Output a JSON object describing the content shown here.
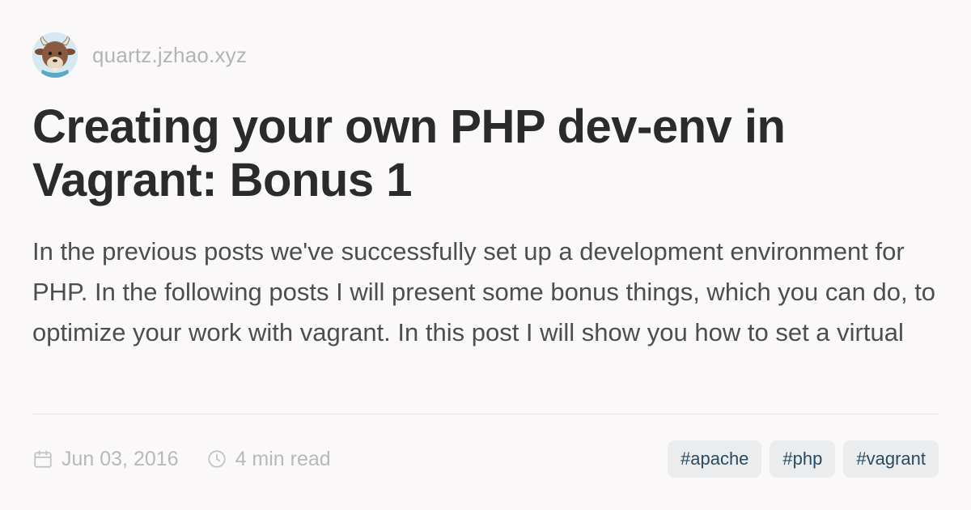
{
  "header": {
    "site_name": "quartz.jzhao.xyz",
    "avatar_icon": "goat-avatar-icon"
  },
  "article": {
    "title": "Creating your own PHP dev-env in Vagrant: Bonus 1",
    "description": "In the previous posts we've successfully set up a development environment for PHP. In the following posts I will present some bonus things, which you can do, to optimize your work with vagrant. In this post I will show you how to set a virtual host in apache inside your guest system."
  },
  "footer": {
    "date": "Jun 03, 2016",
    "date_icon": "calendar-icon",
    "read_time": "4 min read",
    "read_time_icon": "clock-icon",
    "tags": [
      "#apache",
      "#php",
      "#vagrant"
    ]
  },
  "colors": {
    "background": "#faf8f8",
    "title": "#2b2b2b",
    "muted": "#b4b4b4",
    "tag_bg": "#ebeced",
    "tag_text": "#284b63"
  }
}
